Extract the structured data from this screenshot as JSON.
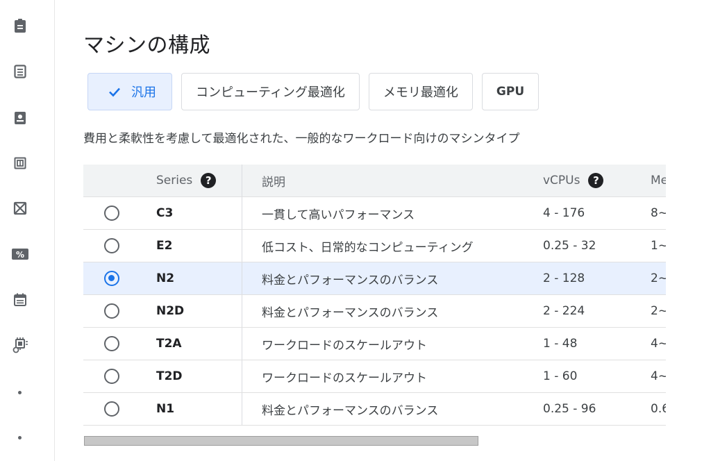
{
  "rail": {
    "items": [
      "document-icon",
      "list-document-icon",
      "badge-icon",
      "grid-box-icon",
      "no-image-icon",
      "percent-tag-icon",
      "calendar-icon",
      "chip-gear-icon"
    ]
  },
  "page": {
    "title": "マシンの構成"
  },
  "chips": [
    {
      "label": "汎用",
      "selected": true
    },
    {
      "label": "コンピューティング最適化",
      "selected": false
    },
    {
      "label": "メモリ最適化",
      "selected": false
    },
    {
      "label": "GPU",
      "selected": false
    }
  ],
  "description": "費用と柔軟性を考慮して最適化された、一般的なワークロード向けのマシンタイプ",
  "table": {
    "headers": {
      "series": "Series",
      "desc": "説明",
      "vcpus": "vCPUs",
      "memory": "Me"
    },
    "rows": [
      {
        "series": "C3",
        "desc": "一貫して高いパフォーマンス",
        "vcpus": "4 - 176",
        "memory": "8~",
        "selected": false
      },
      {
        "series": "E2",
        "desc": "低コスト、日常的なコンピューティング",
        "vcpus": "0.25 - 32",
        "memory": "1~",
        "selected": false
      },
      {
        "series": "N2",
        "desc": "料金とパフォーマンスのバランス",
        "vcpus": "2 - 128",
        "memory": "2~",
        "selected": true
      },
      {
        "series": "N2D",
        "desc": "料金とパフォーマンスのバランス",
        "vcpus": "2 - 224",
        "memory": "2~",
        "selected": false
      },
      {
        "series": "T2A",
        "desc": "ワークロードのスケールアウト",
        "vcpus": "1 - 48",
        "memory": "4~",
        "selected": false
      },
      {
        "series": "T2D",
        "desc": "ワークロードのスケールアウト",
        "vcpus": "1 - 60",
        "memory": "4~",
        "selected": false
      },
      {
        "series": "N1",
        "desc": "料金とパフォーマンスのバランス",
        "vcpus": "0.25 - 96",
        "memory": "0.6",
        "selected": false
      }
    ]
  },
  "colors": {
    "accent": "#1a73e8",
    "selected_bg": "#e8f0fe"
  }
}
